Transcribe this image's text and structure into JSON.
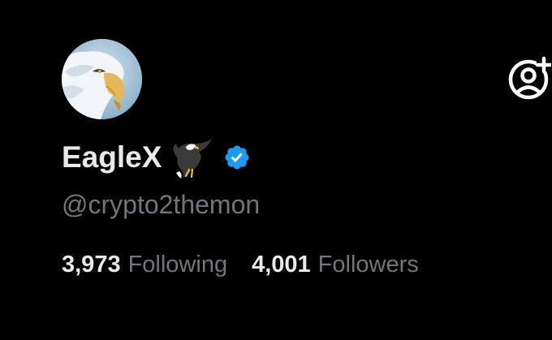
{
  "profile": {
    "display_name": "EagleX",
    "name_emoji": "eagle-emoji",
    "verified": true,
    "verified_color": "#1d9bf0",
    "handle": "@crypto2themon"
  },
  "stats": {
    "following_count": "3,973",
    "following_label": "Following",
    "followers_count": "4,001",
    "followers_label": "Followers"
  },
  "actions": {
    "follow_icon": "add-user-icon"
  },
  "theme": {
    "background": "#000000",
    "primary_text": "#e7e9ea",
    "secondary_text": "#71767b"
  }
}
